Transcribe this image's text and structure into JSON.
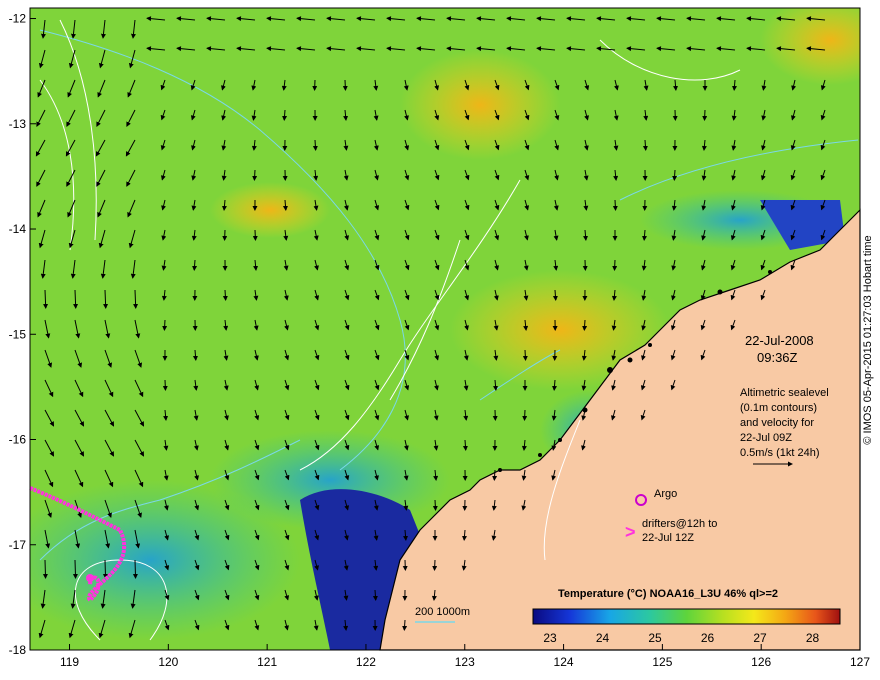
{
  "map": {
    "lon_ticks": [
      "119",
      "120",
      "121",
      "122",
      "123",
      "124",
      "125",
      "126",
      "127"
    ],
    "lat_ticks": [
      "-12",
      "-13",
      "-14",
      "-15",
      "-16",
      "-17",
      "-18"
    ],
    "lon_range": [
      118.6,
      127
    ],
    "lat_range": [
      -18,
      -11.9
    ]
  },
  "annotations": {
    "date": "22-Jul-2008",
    "time": "09:36Z",
    "altimetry_lines": [
      "Altimetric sealevel",
      "(0.1m contours)",
      "and velocity for",
      "22-Jul 09Z",
      "0.5m/s (1kt 24h)"
    ],
    "argo_label": "Argo",
    "drifters_line1": "drifters@12h to",
    "drifters_line2": "22-Jul 12Z",
    "scale_label": "200  1000m"
  },
  "colorbar": {
    "title": "Temperature (°C) NOAA16_L3U 46% ql>=2",
    "ticks": [
      "23",
      "24",
      "25",
      "26",
      "27",
      "28"
    ]
  },
  "credit": "© IMOS 05-Apr-2015 01:27:03 Hobart time",
  "colors": {
    "land": "#f8c9a4",
    "sea_main": "#7fd43a",
    "sea_warm": "#f2c21e",
    "sea_cool": "#2fb89a",
    "sea_deep": "#1a2aa0",
    "contour": "#ffffff",
    "isobath": "#7ad8e8",
    "track": "#ff33dd"
  }
}
